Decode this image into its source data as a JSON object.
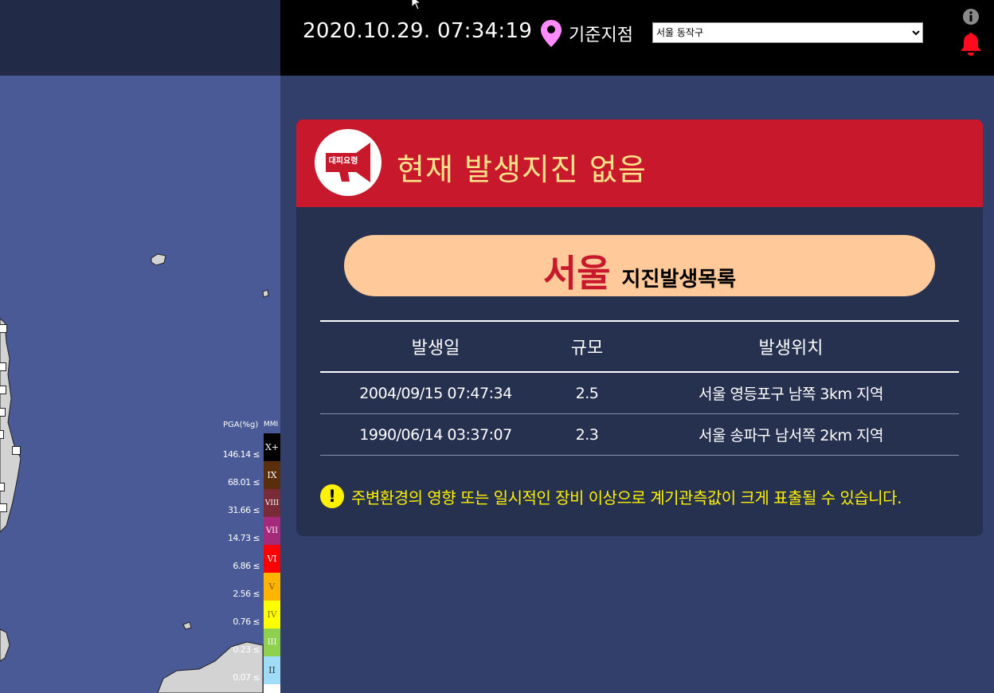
{
  "header": {
    "datetime": "2020.10.29. 07:34:19",
    "ref_label": "기준지점",
    "ref_selected": "서울 동작구"
  },
  "alert": {
    "badge_text": "대피요령",
    "title": "현재 발생지진 없음"
  },
  "region": {
    "name": "서울",
    "suffix": "지진발생목록"
  },
  "table": {
    "headers": [
      "발생일",
      "규모",
      "발생위치"
    ],
    "rows": [
      [
        "2004/09/15 07:47:34",
        "2.5",
        "서울 영등포구 남쪽 3km 지역"
      ],
      [
        "1990/06/14 03:37:07",
        "2.3",
        "서울 송파구 남서쪽 2km 지역"
      ]
    ]
  },
  "notice": {
    "icon": "!",
    "text": "주변환경의 영향 또는 일시적인 장비 이상으로 계기관측값이 크게 표출될 수 있습니다."
  },
  "legend": {
    "pga_header": "PGA(%g)",
    "mmi_header": "MMI",
    "levels": [
      {
        "mmi": "X+",
        "pga": "146.14 ≤",
        "color": "#000000",
        "text": "#ffffff"
      },
      {
        "mmi": "IX",
        "pga": "68.01 ≤",
        "color": "#5a2d0c",
        "text": "#ffffff"
      },
      {
        "mmi": "VIII",
        "pga": "31.66 ≤",
        "color": "#7a2b38",
        "text": "#ffffff"
      },
      {
        "mmi": "VII",
        "pga": "14.73 ≤",
        "color": "#a52a79",
        "text": "#ffffff"
      },
      {
        "mmi": "VI",
        "pga": "6.86 ≤",
        "color": "#ff0000",
        "text": "#ffffff"
      },
      {
        "mmi": "V",
        "pga": "2.56 ≤",
        "color": "#ffb400",
        "text": "#8a5a00"
      },
      {
        "mmi": "IV",
        "pga": "0.76 ≤",
        "color": "#ffff00",
        "text": "#8a7a00"
      },
      {
        "mmi": "III",
        "pga": "0.23 ≤",
        "color": "#8fd14f",
        "text": "#ffffff"
      },
      {
        "mmi": "II",
        "pga": "0.07 ≤",
        "color": "#a0dcf5",
        "text": "#333333"
      }
    ]
  },
  "colors": {
    "alert_red": "#c8192c",
    "title_yellow": "#ffe38a",
    "pill_peach": "#ffc999",
    "notice_yellow": "#fff200",
    "card_bg": "#263150",
    "page_bg": "#333f6b"
  },
  "icons": [
    "location-pin-icon",
    "info-icon",
    "bell-icon",
    "megaphone-icon",
    "warning-icon",
    "cursor-icon"
  ]
}
